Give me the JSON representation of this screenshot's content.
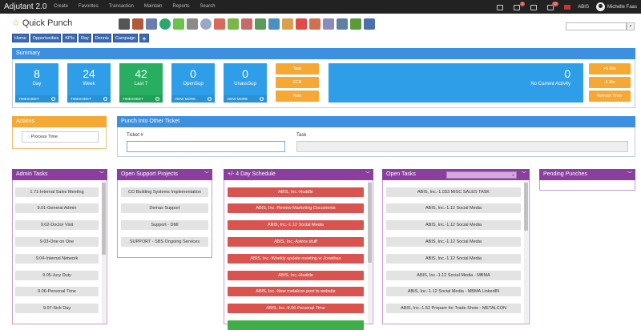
{
  "app": {
    "brand": "Adjutant 2.0",
    "page_title": "Quick Punch"
  },
  "topmenu": [
    "Create",
    "Favorites",
    "Transaction",
    "Maintain",
    "Reports",
    "Search"
  ],
  "topright": {
    "badge1": "2",
    "badge2": "17",
    "org": "ABIS",
    "user": "Michelle Faas"
  },
  "tabs": [
    "Home",
    "Opportunities",
    "KPIs",
    "Ray",
    "Dennis",
    "Campaign",
    "+"
  ],
  "summary": {
    "title": "Summary",
    "tiles": [
      {
        "num": "8",
        "label": "Day",
        "foot": "TIMESHEET",
        "color": "#2f9ee8"
      },
      {
        "num": "24",
        "label": "Week",
        "foot": "TIMESHEET",
        "color": "#2f9ee8"
      },
      {
        "num": "42",
        "label": "Last 7",
        "foot": "TIMESHEET",
        "color": "#27ae60"
      },
      {
        "num": "0",
        "label": "OpenSup",
        "foot": "VIEW MORE",
        "color": "#2f9ee8"
      },
      {
        "num": "0",
        "label": "UnassSup",
        "foot": "VIEW MORE",
        "color": "#2f9ee8"
      }
    ],
    "mid_buttons": [
      "Task",
      "ECR",
      "Note"
    ],
    "activity": {
      "num": "0",
      "label": "No Current Activity"
    },
    "right_buttons": [
      "+5 Min",
      "-5 Min",
      "Refresh Timer"
    ]
  },
  "actions": {
    "title": "Actions",
    "process_time": "Process Time"
  },
  "punch": {
    "title": "Punch Into Other Ticket",
    "ticket_label": "Ticket #",
    "task_label": "Task"
  },
  "admin_tasks": {
    "title": "Admin Tasks",
    "items": [
      "1.71-Internal Sales Meeting",
      "9.01-General Admin",
      "9.02-Doctor Visit",
      "9.03-One on One",
      "9.04-Internal Network",
      "9.05-Jury Duty",
      "9.06-Personal Time",
      "9.07-Sick Day"
    ]
  },
  "support_projects": {
    "title": "Open Support Projects",
    "items": [
      "CO Building Systems Implementation",
      "Demax Support",
      "Support - DMI",
      "SUPPORT - SBS Ongoing Services"
    ]
  },
  "schedule": {
    "title": "+/- 4 Day Schedule",
    "items": [
      "ABIS, Inc.-Huddle",
      "ABIS, Inc.-Review Marketing Documents",
      "ABIS, Inc.-1.12 Social Media",
      "ABIS, Inc.-Astros stuff",
      "ABIS, Inc.-Weekly update meeting w Jonathan",
      "ABIS, Inc.-Huddle",
      "ABIS, Inc.-New metalcon post to website",
      "ABIS, Inc.-9.06 Personal Time"
    ]
  },
  "open_tasks": {
    "title": "Open Tasks",
    "items": [
      "ABIS, Inc.-1.033 MISC SALES TASK",
      "ABIS, Inc.-1.12 Social Media",
      "ABIS, Inc.-1.12 Social Media",
      "ABIS, Inc.-1.12 Social Media",
      "ABIS, Inc.-1.12 Social Media",
      "ABIS, Inc.-1.12 Social Media - MBMA",
      "ABIS, Inc.-1.12 Social Media - MBMA LinkedIN",
      "ABIS, Inc.-1.52 Prepare for Trade Show - METALCON"
    ]
  },
  "pending": {
    "title": "Pending Punches"
  }
}
